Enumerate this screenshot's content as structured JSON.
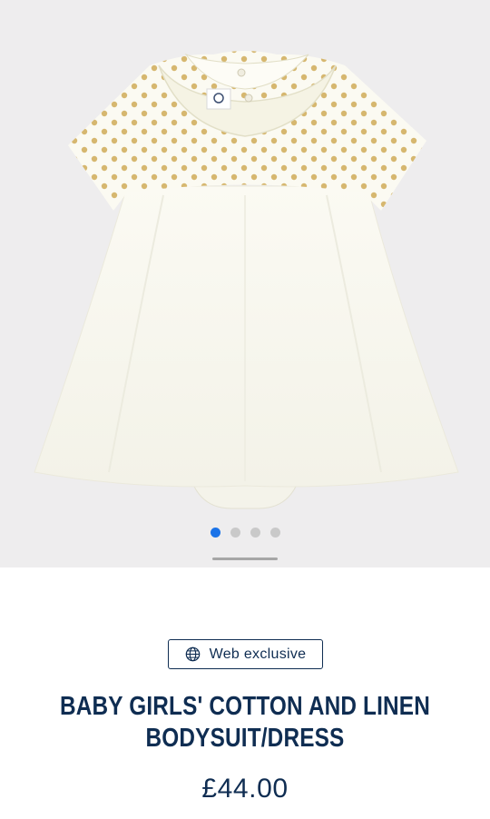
{
  "gallery": {
    "image_alt": "Baby girls' cotton and linen bodysuit dress photo",
    "slide_count": 4,
    "active_slide": 1
  },
  "badge": {
    "icon": "globe-icon",
    "label": "Web exclusive"
  },
  "product": {
    "title_line1": "BABY GIRLS' COTTON AND LINEN",
    "title_line2": "BODYSUIT/DRESS",
    "price": "£44.00"
  },
  "colors": {
    "brand_navy": "#0f2d52",
    "active_dot": "#1a73e8",
    "inactive_dot": "#c9c9c9",
    "gallery_bg": "#eeedee",
    "polka_gold": "#d2b060"
  }
}
